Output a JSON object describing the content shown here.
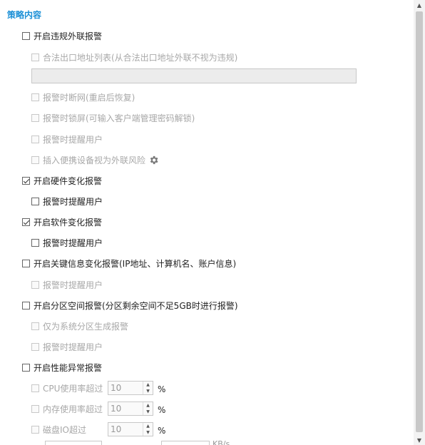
{
  "section_title": "策略内容",
  "violation": {
    "label": "开启违规外联报警",
    "checked": false,
    "legal_list_label": "合法出口地址列表(从合法出口地址外联不视为违规)",
    "legal_list_value": "",
    "cut_network_label": "报警时断网(重启后恢复)",
    "lock_screen_label": "报警时锁屏(可输入客户端管理密码解锁)",
    "notify_user_label": "报警时提醒用户",
    "portable_device_label": "插入便携设备视为外联风险",
    "gear_icon": "gear-icon"
  },
  "hardware": {
    "label": "开启硬件变化报警",
    "checked": true,
    "notify_user_label": "报警时提醒用户"
  },
  "software": {
    "label": "开启软件变化报警",
    "checked": true,
    "notify_user_label": "报警时提醒用户"
  },
  "key_info": {
    "label": "开启关键信息变化报警(IP地址、计算机名、账户信息)",
    "checked": false,
    "notify_user_label": "报警时提醒用户"
  },
  "partition": {
    "label": "开启分区空间报警(分区剩余空间不足5GB时进行报警)",
    "checked": false,
    "system_only_label": "仅为系统分区生成报警",
    "notify_user_label": "报警时提醒用户"
  },
  "performance": {
    "label": "开启性能异常报警",
    "checked": false,
    "cpu_label": "CPU使用率超过",
    "cpu_value": "10",
    "memory_label": "内存使用率超过",
    "memory_value": "10",
    "disk_label": "磁盘IO超过",
    "disk_value": "10",
    "percent": "%",
    "partial_unit": "KB/s"
  },
  "scrollbar": {
    "up_icon": "chevron-up-icon",
    "down_icon": "chevron-down-icon"
  }
}
